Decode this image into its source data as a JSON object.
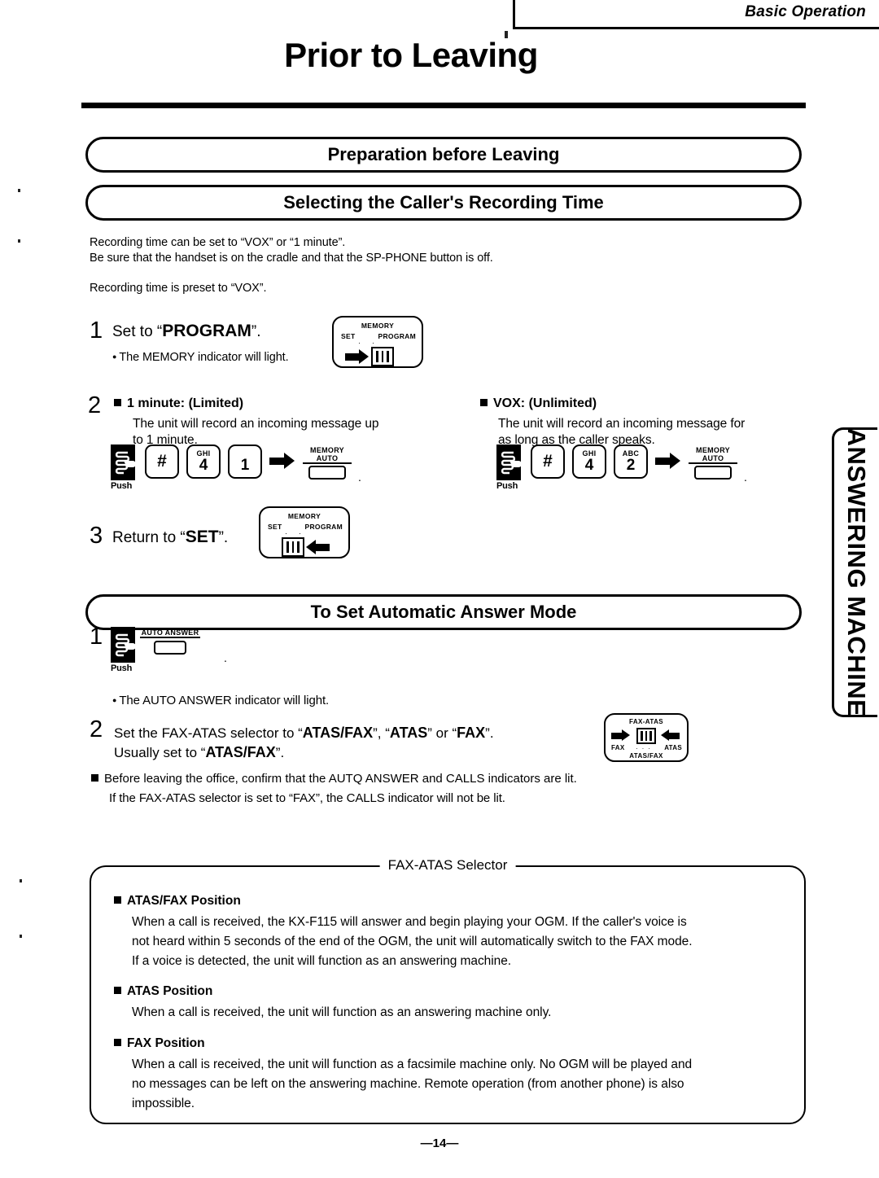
{
  "header": {
    "section_label": "Basic Operation",
    "page_title": "Prior to Leaving"
  },
  "banners": {
    "preparation": "Preparation before Leaving",
    "selecting_time": "Selecting the Caller's Recording Time",
    "auto_answer": "To Set Automatic Answer Mode"
  },
  "intro": {
    "line1": "Recording time can be set to “VOX” or “1 minute”.",
    "line2": "Be sure that the handset is on the cradle and that the SP-PHONE button is off.",
    "line3": "Recording time is preset to “VOX”."
  },
  "steps": {
    "s1_num": "1",
    "s1_text_pre": "Set to “",
    "s1_text_bold": "PROGRAM",
    "s1_text_post": "”.",
    "s1_note": "The MEMORY indicator will light.",
    "s2_num": "2",
    "s3_num": "3",
    "s3_text_pre": "Return to “",
    "s3_text_bold": "SET",
    "s3_text_post": "”."
  },
  "option_limited": {
    "title": "1 minute:  (Limited)",
    "body_line1": "The unit will record an incoming message up",
    "body_line2": "to 1 minute.",
    "keys": [
      {
        "alpha": "",
        "digit": "#"
      },
      {
        "alpha": "GHI",
        "digit": "4"
      },
      {
        "alpha": "",
        "digit": "1"
      }
    ],
    "push_label": "Push",
    "result_line1": "MEMORY",
    "result_line2": "AUTO"
  },
  "option_vox": {
    "title": "VOX:  (Unlimited)",
    "body_line1": "The unit will record an incoming message for",
    "body_line2": "as long as the caller speaks.",
    "keys": [
      {
        "alpha": "",
        "digit": "#"
      },
      {
        "alpha": "GHI",
        "digit": "4"
      },
      {
        "alpha": "ABC",
        "digit": "2"
      }
    ],
    "push_label": "Push",
    "result_line1": "MEMORY",
    "result_line2": "AUTO"
  },
  "memory_switch": {
    "caption": "MEMORY",
    "left_label": "SET",
    "right_label": "PROGRAM"
  },
  "auto_answer_section": {
    "step1_num": "1",
    "push_label": "Push",
    "button_label": "AUTO ANSWER",
    "note": "The AUTO ANSWER indicator will light.",
    "step2_num": "2",
    "step2_line1_a": "Set the FAX-ATAS selector to “",
    "step2_line1_b": "ATAS/FAX",
    "step2_line1_c": "”, “",
    "step2_line1_d": "ATAS",
    "step2_line1_e": "” or “",
    "step2_line1_f": "FAX",
    "step2_line1_g": "”.",
    "step2_line2_a": "Usually set to “",
    "step2_line2_b": "ATAS/FAX",
    "step2_line2_c": "”.",
    "confirm_line1": "Before leaving the office, confirm that the AUTQ ANSWER and CALLS indicators are lit.",
    "confirm_line2": "If the FAX-ATAS selector is set to “FAX”, the CALLS indicator will not be lit."
  },
  "fax_atas_switch": {
    "caption": "FAX-ATAS",
    "left_label": "FAX",
    "right_label": "ATAS",
    "bottom_label": "ATAS/FAX"
  },
  "selector_box": {
    "legend": "FAX-ATAS Selector",
    "items": [
      {
        "title": "ATAS/FAX Position",
        "lines": [
          "When a call is received, the KX-F115 will answer and begin playing your OGM. If the caller's voice is",
          "not heard within 5 seconds of the end of the OGM, the unit will automatically switch to the FAX mode.",
          "If a voice is detected, the unit will function as an answering machine."
        ]
      },
      {
        "title": "ATAS Position",
        "lines": [
          "When a call is received, the unit will function as an answering machine only."
        ]
      },
      {
        "title": "FAX Position",
        "lines": [
          "When a call is received, the unit will function as a facsimile machine only. No OGM will be played and",
          "no messages can be left on the answering machine. Remote operation (from another phone) is also",
          "impossible."
        ]
      }
    ]
  },
  "side_tab": {
    "label": "ANSWERING MACHINE"
  },
  "footer": {
    "page_number": "—14—"
  }
}
